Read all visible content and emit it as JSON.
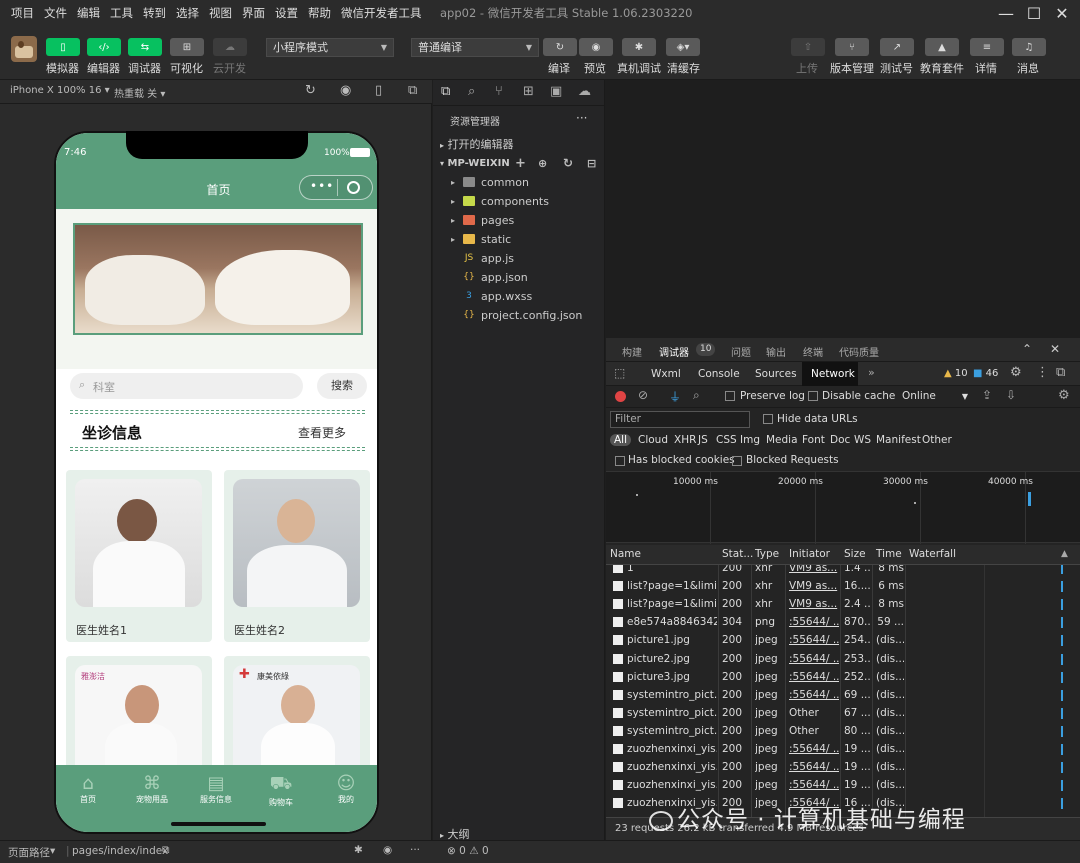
{
  "menu": [
    "项目",
    "文件",
    "编辑",
    "工具",
    "转到",
    "选择",
    "视图",
    "界面",
    "设置",
    "帮助",
    "微信开发者工具"
  ],
  "window_title": "app02 - 微信开发者工具 Stable 1.06.2303220",
  "toolbar": {
    "simulator": "模拟器",
    "editor": "编辑器",
    "debugger": "调试器",
    "visual": "可视化",
    "cloud": "云开发",
    "mode_select": "小程序模式",
    "compile_select": "普通编译",
    "compile": "编译",
    "preview": "预览",
    "real_debug": "真机调试",
    "clear_cache": "清缓存",
    "upload": "上传",
    "version": "版本管理",
    "test_id": "测试号",
    "edu": "教育套件",
    "details": "详情",
    "messages": "消息"
  },
  "simbar": {
    "device": "iPhone X 100% 16",
    "hot_reload": "热重载 关"
  },
  "phone": {
    "time": "7:46",
    "battery": "100%",
    "nav_title": "首页",
    "search_placeholder": "科室",
    "search_button": "搜索",
    "section_title": "坐诊信息",
    "see_more": "查看更多",
    "doctors": [
      {
        "name": "医生姓名1"
      },
      {
        "name": "医生姓名2"
      },
      {
        "name": "",
        "logo": "雅澎洁"
      },
      {
        "name": "",
        "logo": "康美依綠"
      }
    ],
    "tabbar": [
      "首页",
      "宠物用品",
      "服务信息",
      "购物车",
      "我的"
    ]
  },
  "explorer": {
    "title": "资源管理器",
    "open_editors": "打开的编辑器",
    "project": "MP-WEIXIN",
    "items": [
      {
        "name": "common",
        "type": "folder",
        "color": "#8a8a8a"
      },
      {
        "name": "components",
        "type": "folder",
        "color": "#c5d94a"
      },
      {
        "name": "pages",
        "type": "folder",
        "color": "#e0694a"
      },
      {
        "name": "static",
        "type": "folder",
        "color": "#e8b84a"
      },
      {
        "name": "app.js",
        "type": "js",
        "glyph": "JS",
        "color": "#e8c547"
      },
      {
        "name": "app.json",
        "type": "json",
        "glyph": "{}",
        "color": "#e8b84a"
      },
      {
        "name": "app.wxss",
        "type": "wxss",
        "glyph": "3",
        "color": "#3b9fe0"
      },
      {
        "name": "project.config.json",
        "type": "json",
        "glyph": "{}",
        "color": "#e8b84a"
      }
    ],
    "outline": "大纲"
  },
  "devtools": {
    "tabs": [
      "构建",
      "调试器",
      "问题",
      "输出",
      "终端",
      "代码质量"
    ],
    "debugger_badge": "10",
    "subtabs": [
      "Wxml",
      "Console",
      "Sources",
      "Network"
    ],
    "warnings": "10",
    "messages": "46",
    "preserve_log": "Preserve log",
    "disable_cache": "Disable cache",
    "throttle": "Online",
    "filter_placeholder": "Filter",
    "hide_data_urls": "Hide data URLs",
    "types": [
      "All",
      "Cloud",
      "XHR",
      "JS",
      "CSS",
      "Img",
      "Media",
      "Font",
      "Doc",
      "WS",
      "Manifest",
      "Other"
    ],
    "has_blocked_cookies": "Has blocked cookies",
    "blocked_requests": "Blocked Requests",
    "timeline_ticks": [
      "10000 ms",
      "20000 ms",
      "30000 ms",
      "40000 ms"
    ],
    "columns": [
      "Name",
      "Stat...",
      "Type",
      "Initiator",
      "Size",
      "Time",
      "Waterfall"
    ],
    "rows": [
      {
        "name": "1",
        "status": "200",
        "type": "xhr",
        "initiator": "VM9 as...",
        "size": "1.4 ...",
        "time": "8 ms",
        "link": true
      },
      {
        "name": "list?page=1&limi...",
        "status": "200",
        "type": "xhr",
        "initiator": "VM9 as...",
        "size": "16....",
        "time": "6 ms",
        "link": true
      },
      {
        "name": "list?page=1&limi...",
        "status": "200",
        "type": "xhr",
        "initiator": "VM9 as...",
        "size": "2.4 ...",
        "time": "8 ms",
        "link": true
      },
      {
        "name": "e8e574a8846342...",
        "status": "304",
        "type": "png",
        "initiator": ":55644/ ...",
        "size": "870...",
        "time": "59 ...",
        "link": true
      },
      {
        "name": "picture1.jpg",
        "status": "200",
        "type": "jpeg",
        "initiator": ":55644/ ...",
        "size": "254...",
        "time": "(dis...",
        "link": true
      },
      {
        "name": "picture2.jpg",
        "status": "200",
        "type": "jpeg",
        "initiator": ":55644/ ...",
        "size": "253...",
        "time": "(dis...",
        "link": true
      },
      {
        "name": "picture3.jpg",
        "status": "200",
        "type": "jpeg",
        "initiator": ":55644/ ...",
        "size": "252...",
        "time": "(dis...",
        "link": true
      },
      {
        "name": "systemintro_pict...",
        "status": "200",
        "type": "jpeg",
        "initiator": ":55644/ ...",
        "size": "69 ...",
        "time": "(dis...",
        "link": true
      },
      {
        "name": "systemintro_pict...",
        "status": "200",
        "type": "jpeg",
        "initiator": "Other",
        "size": "67 ...",
        "time": "(dis...",
        "link": false
      },
      {
        "name": "systemintro_pict...",
        "status": "200",
        "type": "jpeg",
        "initiator": "Other",
        "size": "80 ...",
        "time": "(dis...",
        "link": false
      },
      {
        "name": "zuozhenxinxi_yis...",
        "status": "200",
        "type": "jpeg",
        "initiator": ":55644/ ...",
        "size": "19 ...",
        "time": "(dis...",
        "link": true
      },
      {
        "name": "zuozhenxinxi_yis...",
        "status": "200",
        "type": "jpeg",
        "initiator": ":55644/ ...",
        "size": "19 ...",
        "time": "(dis...",
        "link": true
      },
      {
        "name": "zuozhenxinxi_yis...",
        "status": "200",
        "type": "jpeg",
        "initiator": ":55644/ ...",
        "size": "19 ...",
        "time": "(dis...",
        "link": true
      },
      {
        "name": "zuozhenxinxi_yis...",
        "status": "200",
        "type": "jpeg",
        "initiator": ":55644/ ...",
        "size": "16 ...",
        "time": "(dis...",
        "link": true
      }
    ],
    "summary": "23 requests  26.2 kB transferred  4.9 MB resources"
  },
  "statusbar": {
    "path_label": "页面路径",
    "path": "pages/index/index",
    "errors": "0",
    "warnings": "0"
  },
  "watermark": "公众号 · 计算机基础与编程",
  "colors": {
    "green": "#07c160",
    "phone_green": "#5a9e7c",
    "accent_blue": "#3b9fe0"
  }
}
